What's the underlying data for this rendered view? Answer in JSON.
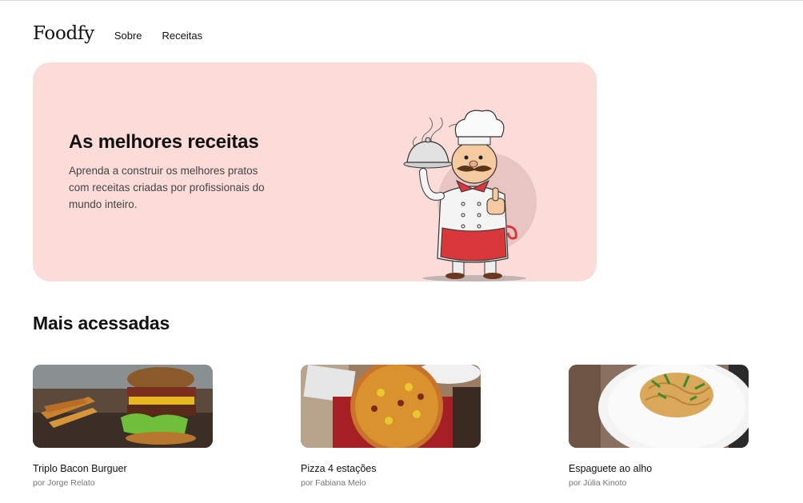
{
  "header": {
    "logo": "Foodfy",
    "nav": [
      {
        "label": "Sobre"
      },
      {
        "label": "Receitas"
      }
    ]
  },
  "hero": {
    "title": "As melhores receitas",
    "description": "Aprenda a construir os melhores pratos com receitas criadas por profissionais do mundo inteiro.",
    "illustration": "chef-illustration",
    "background": "#fcdcd9"
  },
  "section": {
    "title": "Mais acessadas"
  },
  "recipes": [
    {
      "title": "Triplo Bacon Burguer",
      "author": "por Jorge Relato",
      "image": "burger-photo"
    },
    {
      "title": "Pizza 4 estações",
      "author": "por Fabiana Melo",
      "image": "pizza-photo"
    },
    {
      "title": "Espaguete ao alho",
      "author": "por Júlia Kinoto",
      "image": "spaghetti-photo"
    }
  ]
}
